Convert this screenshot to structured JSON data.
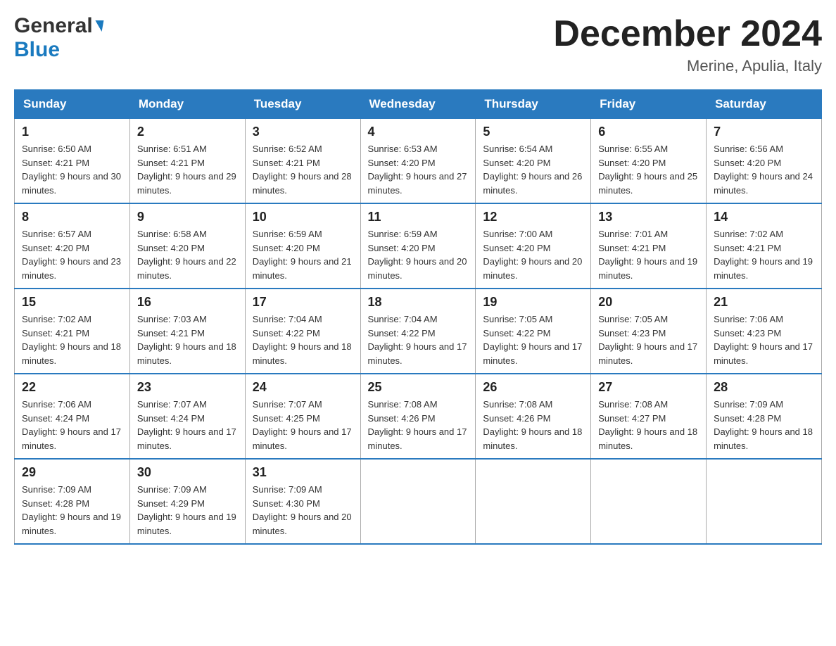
{
  "header": {
    "logo_general": "General",
    "logo_blue": "Blue",
    "month_title": "December 2024",
    "location": "Merine, Apulia, Italy"
  },
  "weekdays": [
    "Sunday",
    "Monday",
    "Tuesday",
    "Wednesday",
    "Thursday",
    "Friday",
    "Saturday"
  ],
  "weeks": [
    [
      {
        "day": "1",
        "sunrise": "6:50 AM",
        "sunset": "4:21 PM",
        "daylight": "9 hours and 30 minutes."
      },
      {
        "day": "2",
        "sunrise": "6:51 AM",
        "sunset": "4:21 PM",
        "daylight": "9 hours and 29 minutes."
      },
      {
        "day": "3",
        "sunrise": "6:52 AM",
        "sunset": "4:21 PM",
        "daylight": "9 hours and 28 minutes."
      },
      {
        "day": "4",
        "sunrise": "6:53 AM",
        "sunset": "4:20 PM",
        "daylight": "9 hours and 27 minutes."
      },
      {
        "day": "5",
        "sunrise": "6:54 AM",
        "sunset": "4:20 PM",
        "daylight": "9 hours and 26 minutes."
      },
      {
        "day": "6",
        "sunrise": "6:55 AM",
        "sunset": "4:20 PM",
        "daylight": "9 hours and 25 minutes."
      },
      {
        "day": "7",
        "sunrise": "6:56 AM",
        "sunset": "4:20 PM",
        "daylight": "9 hours and 24 minutes."
      }
    ],
    [
      {
        "day": "8",
        "sunrise": "6:57 AM",
        "sunset": "4:20 PM",
        "daylight": "9 hours and 23 minutes."
      },
      {
        "day": "9",
        "sunrise": "6:58 AM",
        "sunset": "4:20 PM",
        "daylight": "9 hours and 22 minutes."
      },
      {
        "day": "10",
        "sunrise": "6:59 AM",
        "sunset": "4:20 PM",
        "daylight": "9 hours and 21 minutes."
      },
      {
        "day": "11",
        "sunrise": "6:59 AM",
        "sunset": "4:20 PM",
        "daylight": "9 hours and 20 minutes."
      },
      {
        "day": "12",
        "sunrise": "7:00 AM",
        "sunset": "4:20 PM",
        "daylight": "9 hours and 20 minutes."
      },
      {
        "day": "13",
        "sunrise": "7:01 AM",
        "sunset": "4:21 PM",
        "daylight": "9 hours and 19 minutes."
      },
      {
        "day": "14",
        "sunrise": "7:02 AM",
        "sunset": "4:21 PM",
        "daylight": "9 hours and 19 minutes."
      }
    ],
    [
      {
        "day": "15",
        "sunrise": "7:02 AM",
        "sunset": "4:21 PM",
        "daylight": "9 hours and 18 minutes."
      },
      {
        "day": "16",
        "sunrise": "7:03 AM",
        "sunset": "4:21 PM",
        "daylight": "9 hours and 18 minutes."
      },
      {
        "day": "17",
        "sunrise": "7:04 AM",
        "sunset": "4:22 PM",
        "daylight": "9 hours and 18 minutes."
      },
      {
        "day": "18",
        "sunrise": "7:04 AM",
        "sunset": "4:22 PM",
        "daylight": "9 hours and 17 minutes."
      },
      {
        "day": "19",
        "sunrise": "7:05 AM",
        "sunset": "4:22 PM",
        "daylight": "9 hours and 17 minutes."
      },
      {
        "day": "20",
        "sunrise": "7:05 AM",
        "sunset": "4:23 PM",
        "daylight": "9 hours and 17 minutes."
      },
      {
        "day": "21",
        "sunrise": "7:06 AM",
        "sunset": "4:23 PM",
        "daylight": "9 hours and 17 minutes."
      }
    ],
    [
      {
        "day": "22",
        "sunrise": "7:06 AM",
        "sunset": "4:24 PM",
        "daylight": "9 hours and 17 minutes."
      },
      {
        "day": "23",
        "sunrise": "7:07 AM",
        "sunset": "4:24 PM",
        "daylight": "9 hours and 17 minutes."
      },
      {
        "day": "24",
        "sunrise": "7:07 AM",
        "sunset": "4:25 PM",
        "daylight": "9 hours and 17 minutes."
      },
      {
        "day": "25",
        "sunrise": "7:08 AM",
        "sunset": "4:26 PM",
        "daylight": "9 hours and 17 minutes."
      },
      {
        "day": "26",
        "sunrise": "7:08 AM",
        "sunset": "4:26 PM",
        "daylight": "9 hours and 18 minutes."
      },
      {
        "day": "27",
        "sunrise": "7:08 AM",
        "sunset": "4:27 PM",
        "daylight": "9 hours and 18 minutes."
      },
      {
        "day": "28",
        "sunrise": "7:09 AM",
        "sunset": "4:28 PM",
        "daylight": "9 hours and 18 minutes."
      }
    ],
    [
      {
        "day": "29",
        "sunrise": "7:09 AM",
        "sunset": "4:28 PM",
        "daylight": "9 hours and 19 minutes."
      },
      {
        "day": "30",
        "sunrise": "7:09 AM",
        "sunset": "4:29 PM",
        "daylight": "9 hours and 19 minutes."
      },
      {
        "day": "31",
        "sunrise": "7:09 AM",
        "sunset": "4:30 PM",
        "daylight": "9 hours and 20 minutes."
      },
      null,
      null,
      null,
      null
    ]
  ]
}
